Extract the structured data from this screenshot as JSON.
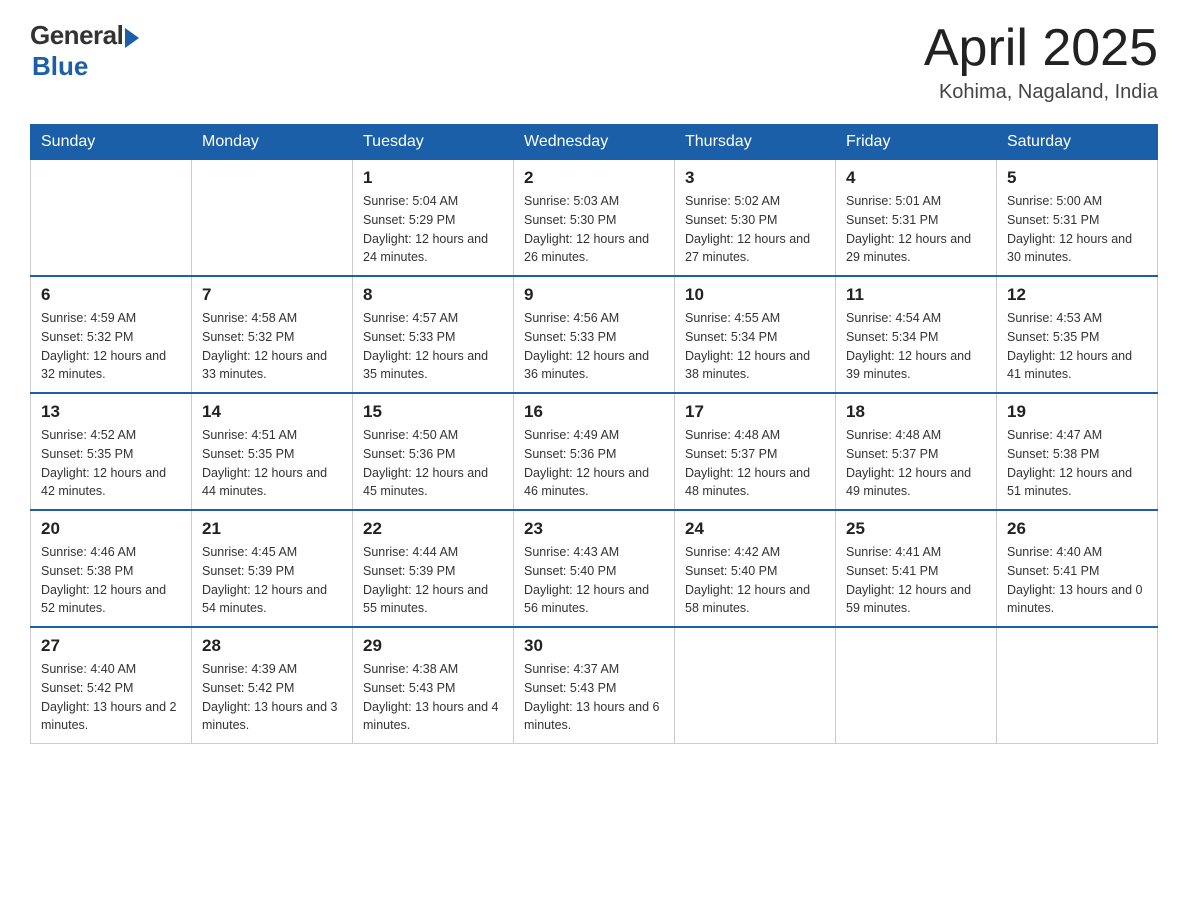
{
  "header": {
    "logo_general": "General",
    "logo_blue": "Blue",
    "title": "April 2025",
    "location": "Kohima, Nagaland, India"
  },
  "weekdays": [
    "Sunday",
    "Monday",
    "Tuesday",
    "Wednesday",
    "Thursday",
    "Friday",
    "Saturday"
  ],
  "weeks": [
    [
      {
        "day": "",
        "sunrise": "",
        "sunset": "",
        "daylight": ""
      },
      {
        "day": "",
        "sunrise": "",
        "sunset": "",
        "daylight": ""
      },
      {
        "day": "1",
        "sunrise": "Sunrise: 5:04 AM",
        "sunset": "Sunset: 5:29 PM",
        "daylight": "Daylight: 12 hours and 24 minutes."
      },
      {
        "day": "2",
        "sunrise": "Sunrise: 5:03 AM",
        "sunset": "Sunset: 5:30 PM",
        "daylight": "Daylight: 12 hours and 26 minutes."
      },
      {
        "day": "3",
        "sunrise": "Sunrise: 5:02 AM",
        "sunset": "Sunset: 5:30 PM",
        "daylight": "Daylight: 12 hours and 27 minutes."
      },
      {
        "day": "4",
        "sunrise": "Sunrise: 5:01 AM",
        "sunset": "Sunset: 5:31 PM",
        "daylight": "Daylight: 12 hours and 29 minutes."
      },
      {
        "day": "5",
        "sunrise": "Sunrise: 5:00 AM",
        "sunset": "Sunset: 5:31 PM",
        "daylight": "Daylight: 12 hours and 30 minutes."
      }
    ],
    [
      {
        "day": "6",
        "sunrise": "Sunrise: 4:59 AM",
        "sunset": "Sunset: 5:32 PM",
        "daylight": "Daylight: 12 hours and 32 minutes."
      },
      {
        "day": "7",
        "sunrise": "Sunrise: 4:58 AM",
        "sunset": "Sunset: 5:32 PM",
        "daylight": "Daylight: 12 hours and 33 minutes."
      },
      {
        "day": "8",
        "sunrise": "Sunrise: 4:57 AM",
        "sunset": "Sunset: 5:33 PM",
        "daylight": "Daylight: 12 hours and 35 minutes."
      },
      {
        "day": "9",
        "sunrise": "Sunrise: 4:56 AM",
        "sunset": "Sunset: 5:33 PM",
        "daylight": "Daylight: 12 hours and 36 minutes."
      },
      {
        "day": "10",
        "sunrise": "Sunrise: 4:55 AM",
        "sunset": "Sunset: 5:34 PM",
        "daylight": "Daylight: 12 hours and 38 minutes."
      },
      {
        "day": "11",
        "sunrise": "Sunrise: 4:54 AM",
        "sunset": "Sunset: 5:34 PM",
        "daylight": "Daylight: 12 hours and 39 minutes."
      },
      {
        "day": "12",
        "sunrise": "Sunrise: 4:53 AM",
        "sunset": "Sunset: 5:35 PM",
        "daylight": "Daylight: 12 hours and 41 minutes."
      }
    ],
    [
      {
        "day": "13",
        "sunrise": "Sunrise: 4:52 AM",
        "sunset": "Sunset: 5:35 PM",
        "daylight": "Daylight: 12 hours and 42 minutes."
      },
      {
        "day": "14",
        "sunrise": "Sunrise: 4:51 AM",
        "sunset": "Sunset: 5:35 PM",
        "daylight": "Daylight: 12 hours and 44 minutes."
      },
      {
        "day": "15",
        "sunrise": "Sunrise: 4:50 AM",
        "sunset": "Sunset: 5:36 PM",
        "daylight": "Daylight: 12 hours and 45 minutes."
      },
      {
        "day": "16",
        "sunrise": "Sunrise: 4:49 AM",
        "sunset": "Sunset: 5:36 PM",
        "daylight": "Daylight: 12 hours and 46 minutes."
      },
      {
        "day": "17",
        "sunrise": "Sunrise: 4:48 AM",
        "sunset": "Sunset: 5:37 PM",
        "daylight": "Daylight: 12 hours and 48 minutes."
      },
      {
        "day": "18",
        "sunrise": "Sunrise: 4:48 AM",
        "sunset": "Sunset: 5:37 PM",
        "daylight": "Daylight: 12 hours and 49 minutes."
      },
      {
        "day": "19",
        "sunrise": "Sunrise: 4:47 AM",
        "sunset": "Sunset: 5:38 PM",
        "daylight": "Daylight: 12 hours and 51 minutes."
      }
    ],
    [
      {
        "day": "20",
        "sunrise": "Sunrise: 4:46 AM",
        "sunset": "Sunset: 5:38 PM",
        "daylight": "Daylight: 12 hours and 52 minutes."
      },
      {
        "day": "21",
        "sunrise": "Sunrise: 4:45 AM",
        "sunset": "Sunset: 5:39 PM",
        "daylight": "Daylight: 12 hours and 54 minutes."
      },
      {
        "day": "22",
        "sunrise": "Sunrise: 4:44 AM",
        "sunset": "Sunset: 5:39 PM",
        "daylight": "Daylight: 12 hours and 55 minutes."
      },
      {
        "day": "23",
        "sunrise": "Sunrise: 4:43 AM",
        "sunset": "Sunset: 5:40 PM",
        "daylight": "Daylight: 12 hours and 56 minutes."
      },
      {
        "day": "24",
        "sunrise": "Sunrise: 4:42 AM",
        "sunset": "Sunset: 5:40 PM",
        "daylight": "Daylight: 12 hours and 58 minutes."
      },
      {
        "day": "25",
        "sunrise": "Sunrise: 4:41 AM",
        "sunset": "Sunset: 5:41 PM",
        "daylight": "Daylight: 12 hours and 59 minutes."
      },
      {
        "day": "26",
        "sunrise": "Sunrise: 4:40 AM",
        "sunset": "Sunset: 5:41 PM",
        "daylight": "Daylight: 13 hours and 0 minutes."
      }
    ],
    [
      {
        "day": "27",
        "sunrise": "Sunrise: 4:40 AM",
        "sunset": "Sunset: 5:42 PM",
        "daylight": "Daylight: 13 hours and 2 minutes."
      },
      {
        "day": "28",
        "sunrise": "Sunrise: 4:39 AM",
        "sunset": "Sunset: 5:42 PM",
        "daylight": "Daylight: 13 hours and 3 minutes."
      },
      {
        "day": "29",
        "sunrise": "Sunrise: 4:38 AM",
        "sunset": "Sunset: 5:43 PM",
        "daylight": "Daylight: 13 hours and 4 minutes."
      },
      {
        "day": "30",
        "sunrise": "Sunrise: 4:37 AM",
        "sunset": "Sunset: 5:43 PM",
        "daylight": "Daylight: 13 hours and 6 minutes."
      },
      {
        "day": "",
        "sunrise": "",
        "sunset": "",
        "daylight": ""
      },
      {
        "day": "",
        "sunrise": "",
        "sunset": "",
        "daylight": ""
      },
      {
        "day": "",
        "sunrise": "",
        "sunset": "",
        "daylight": ""
      }
    ]
  ]
}
